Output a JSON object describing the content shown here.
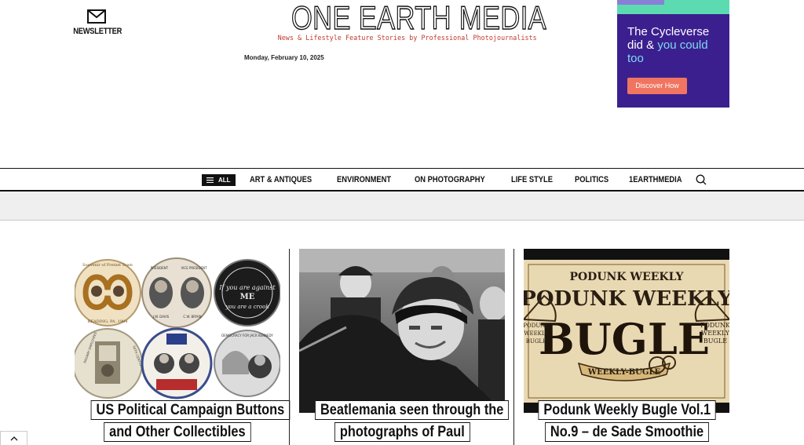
{
  "header": {
    "newsletter_label": "NEWSLETTER",
    "logo": "ONE EARTH MEDIA",
    "tagline": "News & Lifestyle Feature Stories by Professional Photojournalists",
    "date": "Monday, February 10, 2025"
  },
  "ad": {
    "line1": "The Cycleverse",
    "line2a": "did & ",
    "line2b": "you could",
    "line3": "too",
    "button": "Discover How",
    "colors": {
      "background": "#3b1f8f",
      "accent": "#5ddbb0",
      "button": "#f07560",
      "highlight": "#7fd9f0"
    }
  },
  "nav": {
    "all_label": "ALL",
    "items": [
      "ART & ANTIQUES",
      "ENVIRONMENT",
      "ON PHOTOGRAPHY",
      "LIFE STYLE",
      "POLITICS",
      "1EARTHMEDIA"
    ],
    "search_icon": "search-icon"
  },
  "cards": [
    {
      "title_lines": [
        "US Political Campaign Buttons",
        "and Other Collectibles"
      ]
    },
    {
      "title_lines": [
        "Beatlemania seen through the",
        "photographs of Paul"
      ]
    },
    {
      "title_lines": [
        "Podunk Weekly Bugle Vol.1",
        "No.9 – de Sade Smoothie"
      ]
    }
  ],
  "images": {
    "buttons_art": {
      "t1": "Souvenir of Pretzel Town",
      "t2": "READING, PA. 1904",
      "t3": "PRESIDENT",
      "t4": "VICE PRESIDENT",
      "t5": "J.W. DAVIS",
      "t6": "C.W. BRYAN",
      "t7": "If you are against",
      "t8": "ME",
      "t9": "you are a crook",
      "t10": "RAILWAY EMPLOYEES",
      "t11": "50TH CENTURY CLUB",
      "t12": "DEMOCRACY FOR JACK KENNEDY"
    },
    "bugle_art": {
      "top": "PODUNK WEEKLY",
      "mid": "PODUNK WEEKLY",
      "big": "BUGLE",
      "ribbon": "WEEKLY-BUGLE",
      "side1": "PODUNK",
      "side2": "WEEKLY",
      "side3": "BUGLE",
      "left1": "PODUNK",
      "left2": "WEEKLY",
      "left3": "BUGLE"
    }
  }
}
